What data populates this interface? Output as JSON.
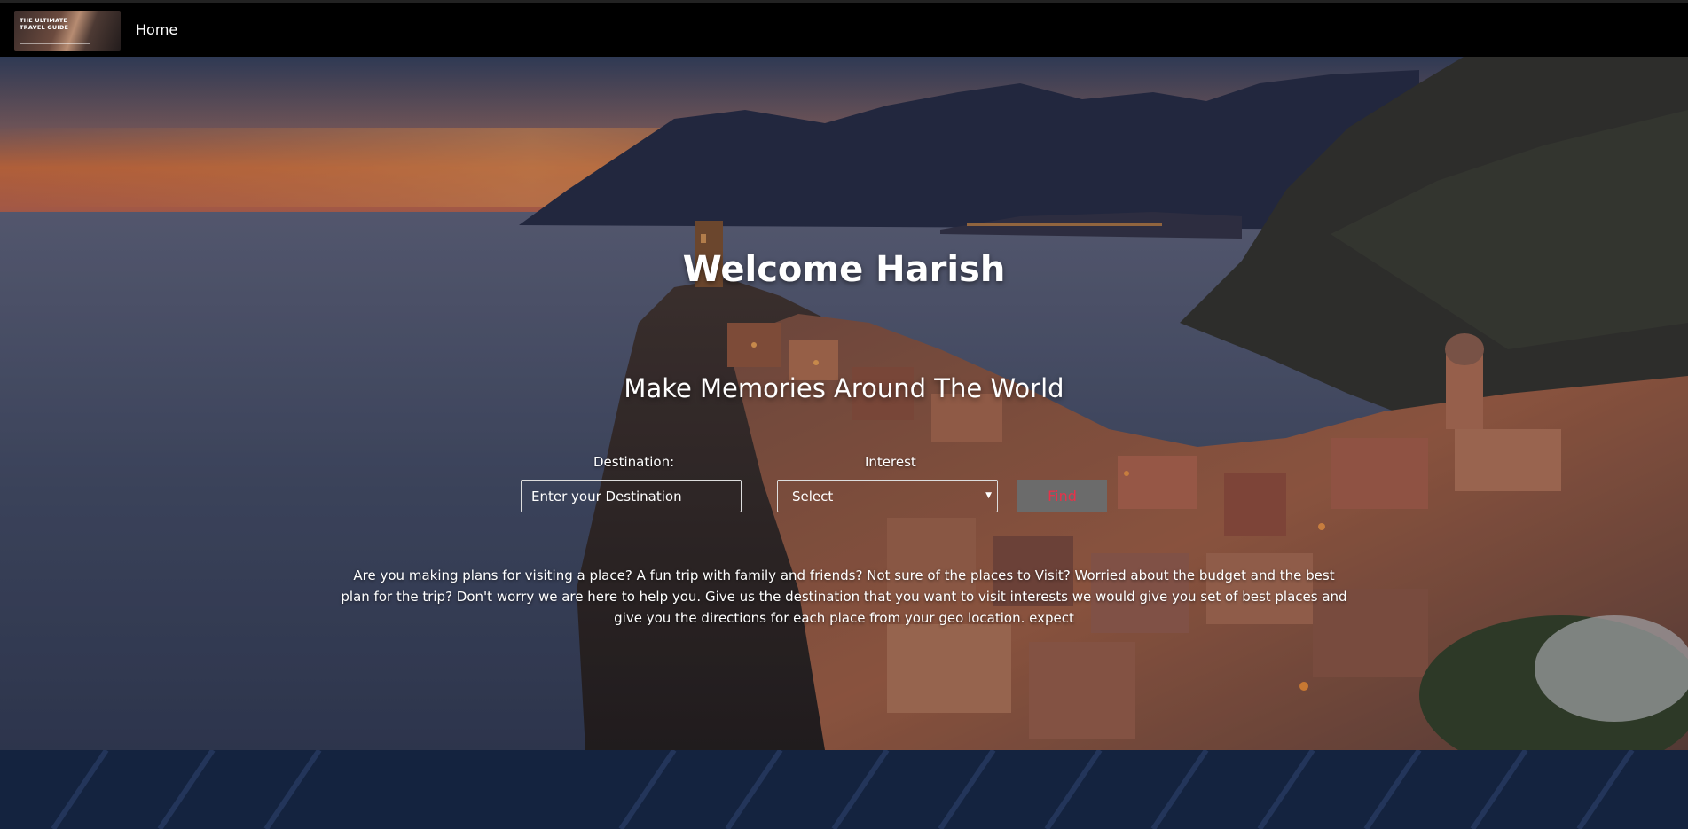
{
  "navbar": {
    "logo_text": "THE ULTIMATE TRAVEL GUIDE",
    "home_label": "Home"
  },
  "hero": {
    "welcome": "Welcome Harish",
    "tagline": "Make Memories Around The World",
    "destination_label": "Destination:",
    "destination_placeholder": "Enter your Destination",
    "interest_label": "Interest",
    "interest_selected": "Select",
    "find_label": "Find",
    "description": "Are you making plans for visiting a place? A fun trip with family and friends? Not sure of the places to Visit? Worried about the budget and the best plan for the trip? Don't worry we are here to help you. Give us the destination that you want to visit interests we would give you set of best places and give you the directions for each place from your geo location. expect"
  },
  "colors": {
    "navbar_bg": "#000000",
    "find_button_bg": "#6b6b6b",
    "find_button_text": "#e6334a",
    "footer_band": "#14233f"
  },
  "icons": {
    "select_arrow": "chevron-down-icon"
  }
}
